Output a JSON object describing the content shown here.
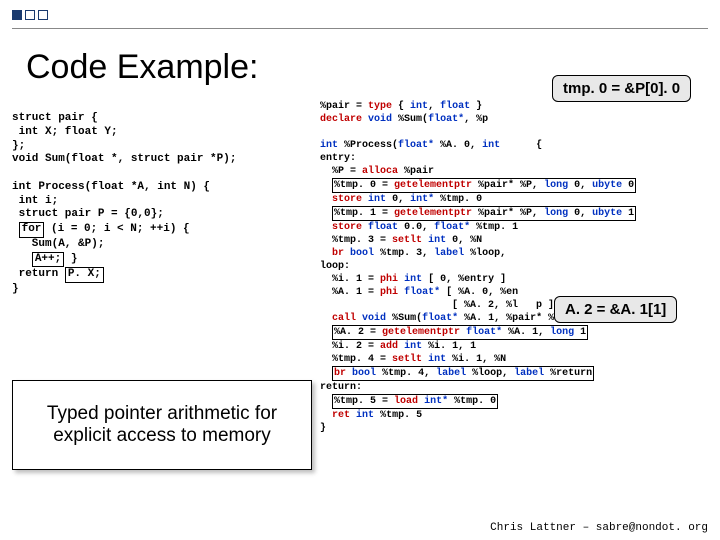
{
  "title": "Code Example:",
  "annotation": "Typed pointer arithmetic for explicit access to memory",
  "callout1": "tmp. 0 = &P[0]. 0",
  "callout2": "A. 2 = &A. 1[1]",
  "footer": "Chris Lattner – sabre@nondot. org",
  "src": {
    "l1": "struct pair {",
    "l2": " int X; float Y;",
    "l3": "};",
    "l4": "void Sum(float *, struct pair *P);",
    "l5": "int Process(float *A, int N) {",
    "l6": " int i;",
    "l7": " struct pair P = {0,0};",
    "l8a": "for",
    "l8b": " (i = 0; i < N; ++i) {",
    "l9": "   Sum(A, &P);",
    "l10a": "A++;",
    "l10b": " }",
    "l11a": "return",
    "l11b": "P. X;",
    "l12": "}"
  },
  "ir": {
    "p1": "%pair = ",
    "l1a": "type",
    "l1b": " { ",
    "l1c": "int",
    "l1d": ", ",
    "l1e": "float",
    "l1f": " }",
    "l2a": "declare",
    "l2b": "void",
    "l2c": " %Sum(",
    "l2d": "float*",
    "l2e": ", %p",
    "l3a": "int",
    "l3b": " %Process(",
    "l3c": "float*",
    "l3d": " %A. 0, ",
    "l3e": "int",
    "l3f": "      {",
    "l4": "entry:",
    "l5a": "  %P = ",
    "l5b": "alloca",
    "l5c": " %pair",
    "l6a": "%tmp. 0 = ",
    "l6b": "getelementptr",
    "l6c": " %pair* %P, ",
    "l6d": "long",
    "l6e": " 0, ",
    "l6f": "ubyte",
    "l6g": " 0",
    "l7a": "store",
    "l7b": "int",
    "l7c": " 0, ",
    "l7d": "int*",
    "l7e": " %tmp. 0",
    "l8a": "%tmp. 1 = ",
    "l8b": "getelementptr",
    "l8c": " %pair* %P, ",
    "l8d": "long",
    "l8e": " 0, ",
    "l8f": "ubyte",
    "l8g": " 1",
    "l9a": "store",
    "l9b": "float",
    "l9c": " 0.0, ",
    "l9d": "float*",
    "l9e": " %tmp. 1",
    "l10a": "%tmp. 3 = ",
    "l10b": "setlt",
    "l10c": "int",
    "l10d": " 0, %N",
    "l11a": "br",
    "l11b": "bool",
    "l11c": " %tmp. 3, ",
    "l11d": "label",
    "l11e": " %loop,",
    "l12": "loop:",
    "l13a": "%i. 1 = ",
    "l13b": "phi",
    "l13c": "int",
    "l13d": " [ 0, %entry ]",
    "l14a": "%A. 1 = ",
    "l14b": "phi",
    "l14c": "float*",
    "l14d": " [ %A. 0, %en",
    "l14e": "                      [ %A. 2, %l   p ]",
    "l15a": "call",
    "l15b": "void",
    "l15c": " %Sum(",
    "l15d": "float*",
    "l15e": " %A. 1, %pair* %P)",
    "l16a": "%A. 2 = ",
    "l16b": "getelementptr",
    "l16c": "float*",
    "l16d": " %A. 1, ",
    "l16e": "long",
    "l16f": " 1",
    "l17a": "%i. 2 = ",
    "l17b": "add",
    "l17c": "int",
    "l17d": " %i. 1, 1",
    "l18a": "%tmp. 4 = ",
    "l18b": "setlt",
    "l18c": "int",
    "l18d": " %i. 1, %N",
    "l19a": "br",
    "l19b": "bool",
    "l19c": " %tmp. 4, ",
    "l19d": "label",
    "l19e": " %loop, ",
    "l19f": "label",
    "l19g": " %return",
    "l20": "return:",
    "l21a": "%tmp. 5 = ",
    "l21b": "load",
    "l21c": "int*",
    "l21d": " %tmp. 0",
    "l22a": "ret",
    "l22b": "int",
    "l22c": " %tmp. 5",
    "l23": "}"
  }
}
